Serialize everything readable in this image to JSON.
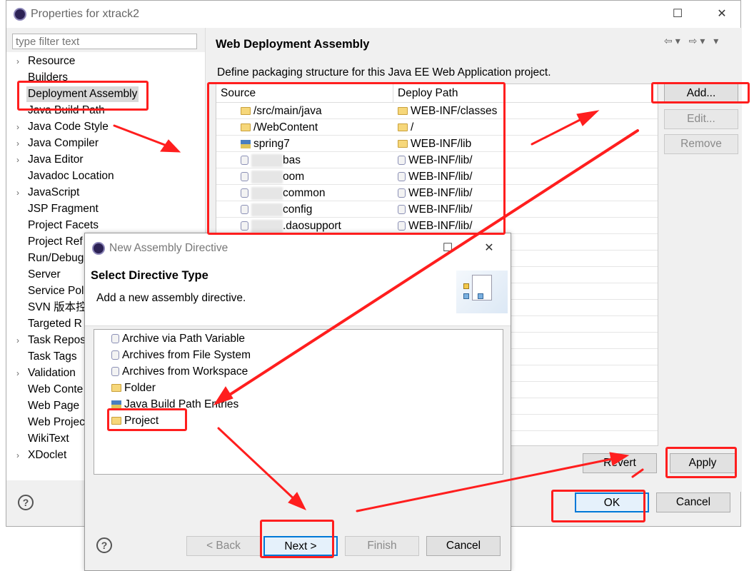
{
  "props_window": {
    "title": "Properties for xtrack2",
    "filter_placeholder": "type filter text",
    "tree": [
      {
        "label": "Resource",
        "arrow": true
      },
      {
        "label": "Builders",
        "arrow": false
      },
      {
        "label": "Deployment Assembly",
        "arrow": false,
        "selected": true
      },
      {
        "label": "Java Build Path",
        "arrow": false
      },
      {
        "label": "Java Code Style",
        "arrow": true
      },
      {
        "label": "Java Compiler",
        "arrow": true
      },
      {
        "label": "Java Editor",
        "arrow": true
      },
      {
        "label": "Javadoc Location",
        "arrow": false
      },
      {
        "label": "JavaScript",
        "arrow": true
      },
      {
        "label": "JSP Fragment",
        "arrow": false
      },
      {
        "label": "Project Facets",
        "arrow": false
      },
      {
        "label": "Project Ref",
        "arrow": false
      },
      {
        "label": "Run/Debug",
        "arrow": false
      },
      {
        "label": "Server",
        "arrow": false
      },
      {
        "label": "Service Pol",
        "arrow": false
      },
      {
        "label": "SVN 版本控",
        "arrow": false
      },
      {
        "label": "Targeted R",
        "arrow": false
      },
      {
        "label": "Task Repos",
        "arrow": true
      },
      {
        "label": "Task Tags",
        "arrow": false
      },
      {
        "label": "Validation",
        "arrow": true
      },
      {
        "label": "Web Conte",
        "arrow": false
      },
      {
        "label": "Web Page",
        "arrow": false
      },
      {
        "label": "Web Projec",
        "arrow": false
      },
      {
        "label": "WikiText",
        "arrow": false
      },
      {
        "label": "XDoclet",
        "arrow": true
      }
    ],
    "page_title": "Web Deployment Assembly",
    "description": "Define packaging structure for this Java EE Web Application project.",
    "table": {
      "col_source": "Source",
      "col_deploy": "Deploy Path",
      "rows": [
        {
          "source": "/src/main/java",
          "deploy": "WEB-INF/classes",
          "icon": "folder-icon",
          "blurred": false
        },
        {
          "source": "/WebContent",
          "deploy": "/",
          "icon": "folder-icon",
          "blurred": false
        },
        {
          "source": "spring7",
          "deploy": "WEB-INF/lib",
          "icon": "library-icon",
          "blurred": false
        },
        {
          "source": "bas",
          "deploy": "WEB-INF/lib/",
          "icon": "project-icon",
          "blurred": true
        },
        {
          "source": "oom",
          "deploy": "WEB-INF/lib/",
          "icon": "project-icon",
          "blurred": true
        },
        {
          "source": "common",
          "deploy": "WEB-INF/lib/",
          "icon": "project-icon",
          "blurred": true
        },
        {
          "source": "config",
          "deploy": "WEB-INF/lib/",
          "icon": "project-icon",
          "blurred": true
        },
        {
          "source": ".daosupport",
          "deploy": "WEB-INF/lib/",
          "icon": "project-icon",
          "blurred": true
        }
      ]
    },
    "buttons": {
      "add": "Add...",
      "edit": "Edit...",
      "remove": "Remove",
      "revert": "Revert",
      "apply": "Apply",
      "ok": "OK",
      "cancel": "Cancel"
    }
  },
  "dialog": {
    "title": "New Assembly Directive",
    "heading": "Select Directive Type",
    "subtitle": "Add a new assembly directive.",
    "items": [
      {
        "label": "Archive via Path Variable",
        "icon": "jar-icon"
      },
      {
        "label": "Archives from File System",
        "icon": "jar-icon"
      },
      {
        "label": "Archives from Workspace",
        "icon": "jar-icon"
      },
      {
        "label": "Folder",
        "icon": "folder-icon"
      },
      {
        "label": "Java Build Path Entries",
        "icon": "library-icon"
      },
      {
        "label": "Project",
        "icon": "open-folder-icon"
      }
    ],
    "buttons": {
      "back": "< Back",
      "next": "Next >",
      "finish": "Finish",
      "cancel": "Cancel"
    }
  },
  "colors": {
    "annotation": "#ff1e1e",
    "focus": "#0078d7"
  }
}
